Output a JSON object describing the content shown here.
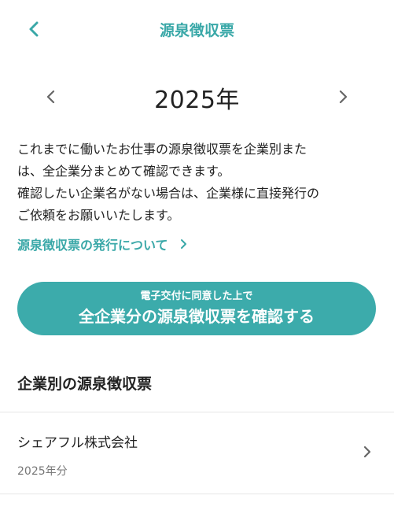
{
  "header": {
    "title": "源泉徴収票",
    "back_icon": "chevron-left-icon"
  },
  "year_selector": {
    "year_label": "2025年",
    "prev_icon": "chevron-left-icon",
    "next_icon": "chevron-right-icon"
  },
  "description": {
    "line1": "これまでに働いたお仕事の源泉徴収票を企業別また",
    "line2": "は、全企業分まとめて確認できます。",
    "line3": "確認したい企業名がない場合は、企業様に直接発行の",
    "line4": "ご依頼をお願いいたします。"
  },
  "about_link": {
    "label": "源泉徴収票の発行について",
    "icon": "chevron-right-icon"
  },
  "confirm_button": {
    "sub_label": "電子交付に同意した上で",
    "main_label": "全企業分の源泉徴収票を確認する"
  },
  "company_section": {
    "title": "企業別の源泉徴収票",
    "items": [
      {
        "name": "シェアフル株式会社",
        "period": "2025年分"
      }
    ]
  },
  "colors": {
    "accent": "#3aa8a8",
    "button_bg": "#3cabab",
    "text": "#222222",
    "muted": "#777777",
    "divider": "#e6e6e6"
  }
}
